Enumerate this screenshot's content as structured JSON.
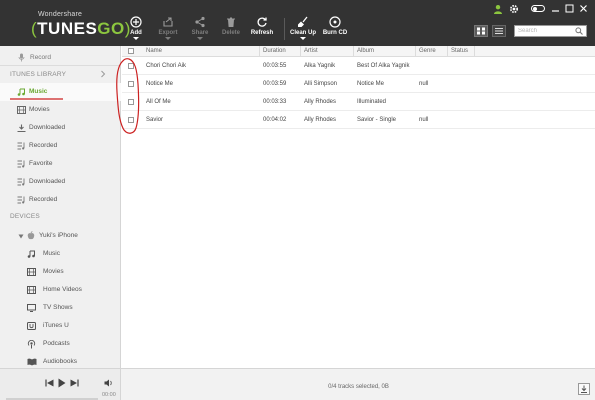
{
  "app": {
    "brand_small": "Wondershare",
    "brand_big_prefix": "TUNES",
    "brand_big_suffix": "GO"
  },
  "toolbar": {
    "add": "Add",
    "export": "Export",
    "share": "Share",
    "delete": "Delete",
    "refresh": "Refresh",
    "clean_up": "Clean Up",
    "burn_cd": "Burn CD"
  },
  "search": {
    "placeholder": "Search",
    "value": ""
  },
  "sidebar": {
    "record": "Record",
    "itunes_library_header": "ITUNES LIBRARY",
    "library": [
      {
        "label": "Music",
        "icon": "music-note-icon"
      },
      {
        "label": "Movies",
        "icon": "film-icon"
      },
      {
        "label": "Downloaded",
        "icon": "download-icon"
      },
      {
        "label": "Recorded",
        "icon": "playlist-icon"
      },
      {
        "label": "Favorite",
        "icon": "playlist-icon"
      },
      {
        "label": "Downloaded",
        "icon": "playlist-icon"
      },
      {
        "label": "Recorded",
        "icon": "playlist-icon"
      }
    ],
    "devices_header": "DEVICES",
    "device_name": "Yuki's iPhone",
    "device_items": [
      {
        "label": "Music",
        "icon": "music-note-icon"
      },
      {
        "label": "Movies",
        "icon": "film-icon"
      },
      {
        "label": "Home Videos",
        "icon": "film-icon"
      },
      {
        "label": "TV Shows",
        "icon": "tv-icon"
      },
      {
        "label": "iTunes U",
        "icon": "itunes-u-icon"
      },
      {
        "label": "Podcasts",
        "icon": "podcast-icon"
      },
      {
        "label": "Audiobooks",
        "icon": "book-icon"
      }
    ]
  },
  "table": {
    "columns": [
      "Name",
      "Duration",
      "Artist",
      "Album",
      "Genre",
      "Status"
    ],
    "rows": [
      {
        "name": "Chori Chori Aik",
        "duration": "00:03:55",
        "artist": "Alka Yagnik",
        "album": "Best Of Alka Yagnik",
        "genre": "",
        "status": ""
      },
      {
        "name": "Notice Me",
        "duration": "00:03:59",
        "artist": "Alli Simpson",
        "album": "Notice Me",
        "genre": "null",
        "status": ""
      },
      {
        "name": "All Of Me",
        "duration": "00:03:33",
        "artist": "Ally Rhodes",
        "album": "Illuminated",
        "genre": "",
        "status": ""
      },
      {
        "name": "Savior",
        "duration": "00:04:02",
        "artist": "Ally Rhodes",
        "album": "Savior - Single",
        "genre": "null",
        "status": ""
      }
    ]
  },
  "bottombar": {
    "status": "0/4 tracks selected, 0B",
    "time": "00:00",
    "progress": 0
  },
  "colors": {
    "accent": "#6aa832",
    "topbar": "#333333",
    "annotation": "#cc2222"
  }
}
